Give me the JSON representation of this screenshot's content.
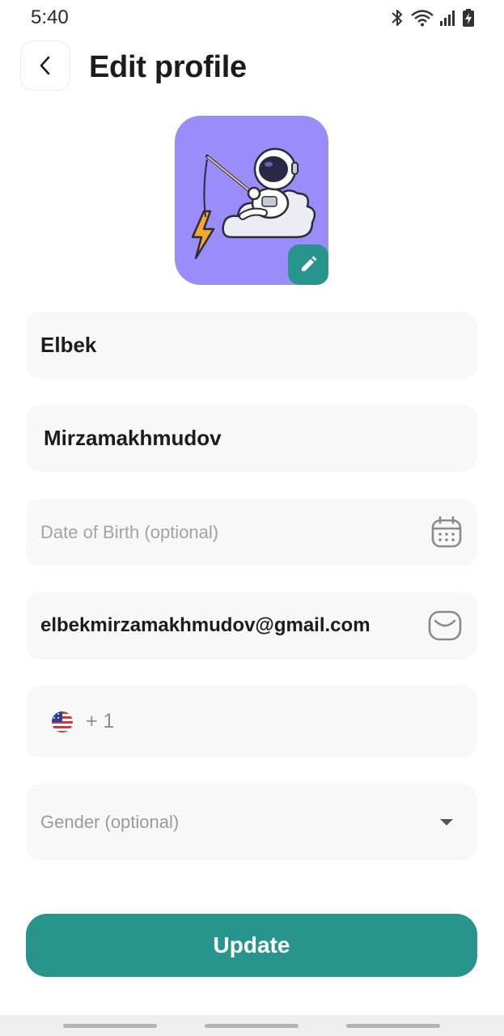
{
  "status_bar": {
    "time": "5:40",
    "icons": [
      "bluetooth-icon",
      "wifi-icon",
      "signal-icon",
      "battery-charging-icon"
    ]
  },
  "header": {
    "back_icon": "chevron-left-icon",
    "title": "Edit profile"
  },
  "avatar": {
    "illustration": "astronaut-fishing-on-cloud",
    "edit_icon": "pencil-icon",
    "background_color": "#9b8df9"
  },
  "form": {
    "first_name": "Elbek",
    "last_name": "Mirzamakhmudov",
    "date_of_birth": {
      "placeholder": "Date of Birth (optional)",
      "icon": "calendar-icon"
    },
    "email": {
      "value": "elbekmirzamakhmudov@gmail.com",
      "icon": "envelope-icon"
    },
    "phone": {
      "flag_icon": "us-flag-icon",
      "prefix": "+ 1"
    },
    "gender": {
      "placeholder": "Gender  (optional)",
      "icon": "dropdown-arrow-icon"
    }
  },
  "update_button": {
    "label": "Update"
  },
  "colors": {
    "accent": "#28958c",
    "field_background": "#f8f8f8",
    "placeholder": "#a3a3a3"
  }
}
